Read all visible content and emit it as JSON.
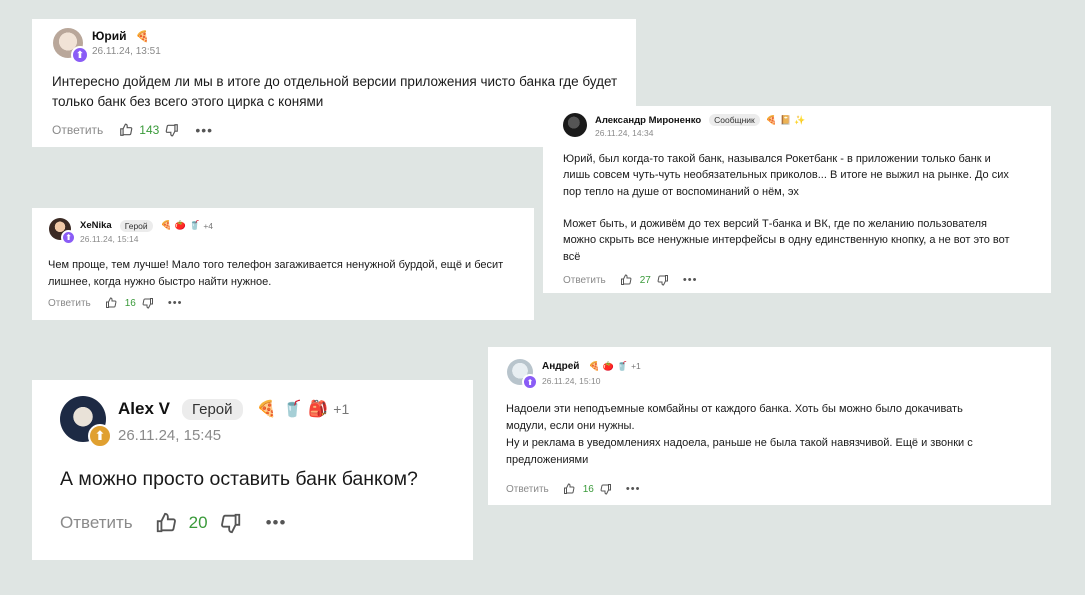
{
  "comments": [
    {
      "name": "Юрий",
      "role": "",
      "emojis": [
        "🍕"
      ],
      "more": "",
      "date": "26.11.24, 13:51",
      "text": [
        "Интересно дойдем ли мы в итоге до отдельной версии приложения чисто банка где будет",
        "только банк без всего этого цирка с конями"
      ],
      "reply": "Ответить",
      "likes": "143"
    },
    {
      "name": "Александр Мироненко",
      "role": "Сообщник",
      "emojis": [
        "🍕",
        "📔",
        "✨"
      ],
      "more": "",
      "date": "26.11.24, 14:34",
      "text": [
        "Юрий, был когда-то такой банк, назывался Рокетбанк - в приложении только банк и",
        "лишь совсем чуть-чуть необязательных приколов... В итоге не выжил на рынке. До сих",
        "пор тепло на душе от воспоминаний о нём, эх",
        "",
        "Может быть, и доживём до тех версий Т-банка и ВК, где по желанию пользователя",
        "можно скрыть все ненужные интерфейсы в одну единственную кнопку, а не вот это вот",
        "всё"
      ],
      "reply": "Ответить",
      "likes": "27"
    },
    {
      "name": "XeNika",
      "role": "Герой",
      "emojis": [
        "🍕",
        "🍅",
        "🥤"
      ],
      "more": "+4",
      "date": "26.11.24, 15:14",
      "text": [
        "Чем проще, тем лучше! Мало того телефон загаживается ненужной бурдой, ещё и бесит",
        "лишнее, когда нужно быстро найти нужное."
      ],
      "reply": "Ответить",
      "likes": "16"
    },
    {
      "name": "Андрей",
      "role": "",
      "emojis": [
        "🍕",
        "🍅",
        "🥤"
      ],
      "more": "+1",
      "date": "26.11.24, 15:10",
      "text": [
        "Надоели эти неподъемные комбайны от каждого банка. Хоть бы можно было докачивать",
        "модули, если они нужны.",
        "Ну и реклама в уведомлениях надоела, раньше не была такой навязчивой. Ещё и звонки с",
        "предложениями"
      ],
      "reply": "Ответить",
      "likes": "16"
    },
    {
      "name": "Alex V",
      "role": "Герой",
      "emojis": [
        "🍕",
        "🥤",
        "🎒"
      ],
      "more": "+1",
      "date": "26.11.24, 15:45",
      "text": [
        "А можно просто оставить банк банком?"
      ],
      "reply": "Ответить",
      "likes": "20"
    }
  ],
  "colors": {
    "background": "#dfe5e3",
    "badge_purple": "#8a5cf6",
    "badge_gold": "#e0a030",
    "likes_green": "#3a9a3a"
  },
  "icons": [
    "like-icon",
    "dislike-icon",
    "more-icon",
    "badge-icon"
  ]
}
